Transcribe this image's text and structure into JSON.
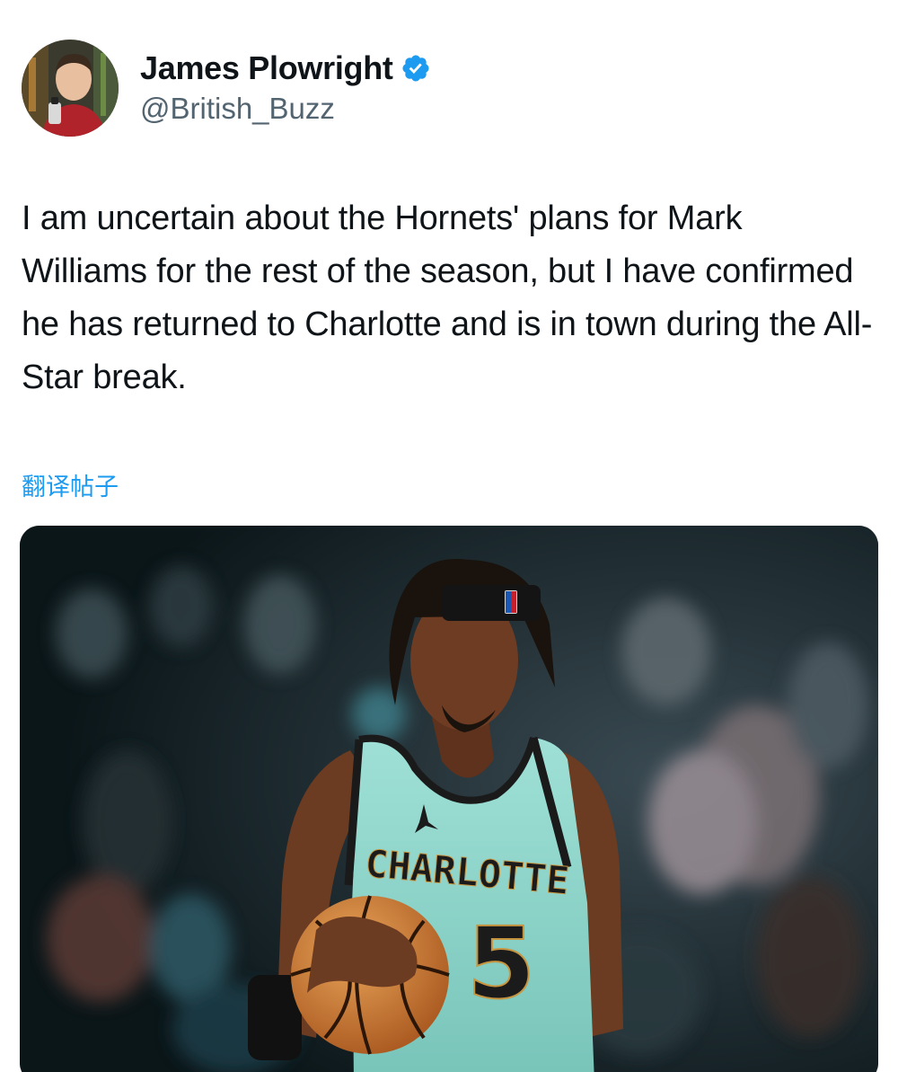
{
  "author": {
    "display_name": "James Plowright",
    "handle": "@British_Buzz",
    "verified": true,
    "avatar_icon": "avatar-photo-icon",
    "verified_icon": "verified-badge-icon",
    "verified_color": "#1d9bf0"
  },
  "tweet": {
    "text": "I am uncertain about the Hornets' plans for Mark Williams for the rest of the season, but I have confirmed he has returned to Charlotte and is in town during the All-Star break.",
    "translate_label": "翻译帖子"
  },
  "media": {
    "jersey_text": "CHARLOTTE",
    "jersey_number": "5",
    "jersey_color": "#8fd6cc"
  },
  "colors": {
    "text": "#0f1419",
    "secondary": "#536471",
    "link": "#1d9bf0"
  }
}
